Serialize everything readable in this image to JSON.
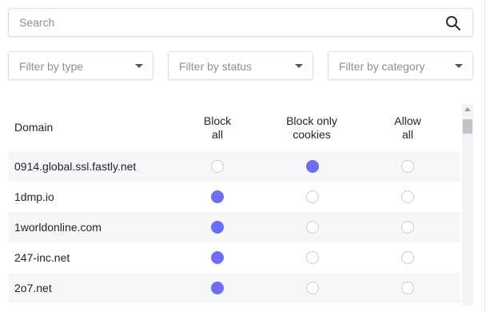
{
  "search": {
    "placeholder": "Search",
    "icon": "search-icon"
  },
  "filters": [
    {
      "label": "Filter by type"
    },
    {
      "label": "Filter by status"
    },
    {
      "label": "Filter by category"
    }
  ],
  "table": {
    "headers": {
      "domain": "Domain",
      "block_all": [
        "Block",
        "all"
      ],
      "block_cookies": [
        "Block only",
        "cookies"
      ],
      "allow_all": [
        "Allow",
        "all"
      ]
    },
    "rows": [
      {
        "domain": "0914.global.ssl.fastly.net",
        "selected": "block_cookies"
      },
      {
        "domain": "1dmp.io",
        "selected": "block_all"
      },
      {
        "domain": "1worldonline.com",
        "selected": "block_all"
      },
      {
        "domain": "247-inc.net",
        "selected": "block_all"
      },
      {
        "domain": "2o7.net",
        "selected": "block_all"
      }
    ]
  },
  "colors": {
    "accent": "#6b6ff2",
    "row_alt": "#f6f7f9",
    "border": "#dcdfe4"
  }
}
